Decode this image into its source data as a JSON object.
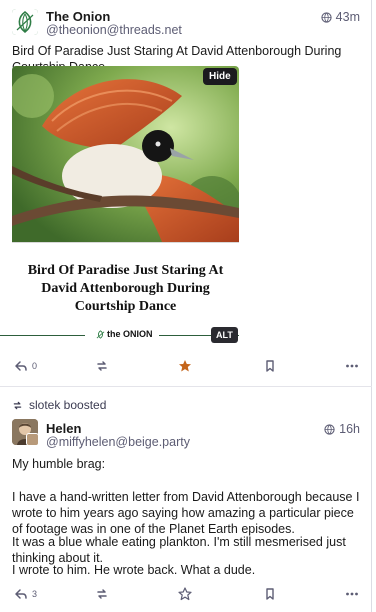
{
  "posts": [
    {
      "author": {
        "display_name": "The Onion",
        "handle": "@theonion@threads.net",
        "avatar_icon": "onion-logo-icon"
      },
      "visibility_icon": "globe-icon",
      "time": "43m",
      "text": "Bird Of Paradise Just Staring At David Attenborough During Courtship Dance",
      "media": {
        "headline": "Bird Of Paradise Just Staring At David Attenborough During Courtship Dance",
        "brand": "the ONION",
        "hide_label": "Hide",
        "alt_label": "ALT"
      },
      "actions": {
        "reply_count": "0",
        "favourited": true
      }
    },
    {
      "boosted_by": "slotek boosted",
      "author": {
        "display_name": "Helen",
        "handle": "@miffyhelen@beige.party"
      },
      "visibility_icon": "globe-icon",
      "time": "16h",
      "paragraphs": [
        "My humble brag:",
        "I have a hand-written letter from David Attenborough because I wrote to him years ago saying how amazing a particular piece of footage was in one of the Planet Earth episodes.",
        "It was a blue whale eating plankton. I'm still mesmerised just thinking about it.",
        "I wrote to him. He wrote back. What a dude."
      ],
      "actions": {
        "reply_count": "3",
        "favourited": false
      }
    }
  ],
  "colors": {
    "favourite_active": "#c4651b",
    "muted_icon": "#5d5d74",
    "onion_green": "#2f7d46"
  }
}
